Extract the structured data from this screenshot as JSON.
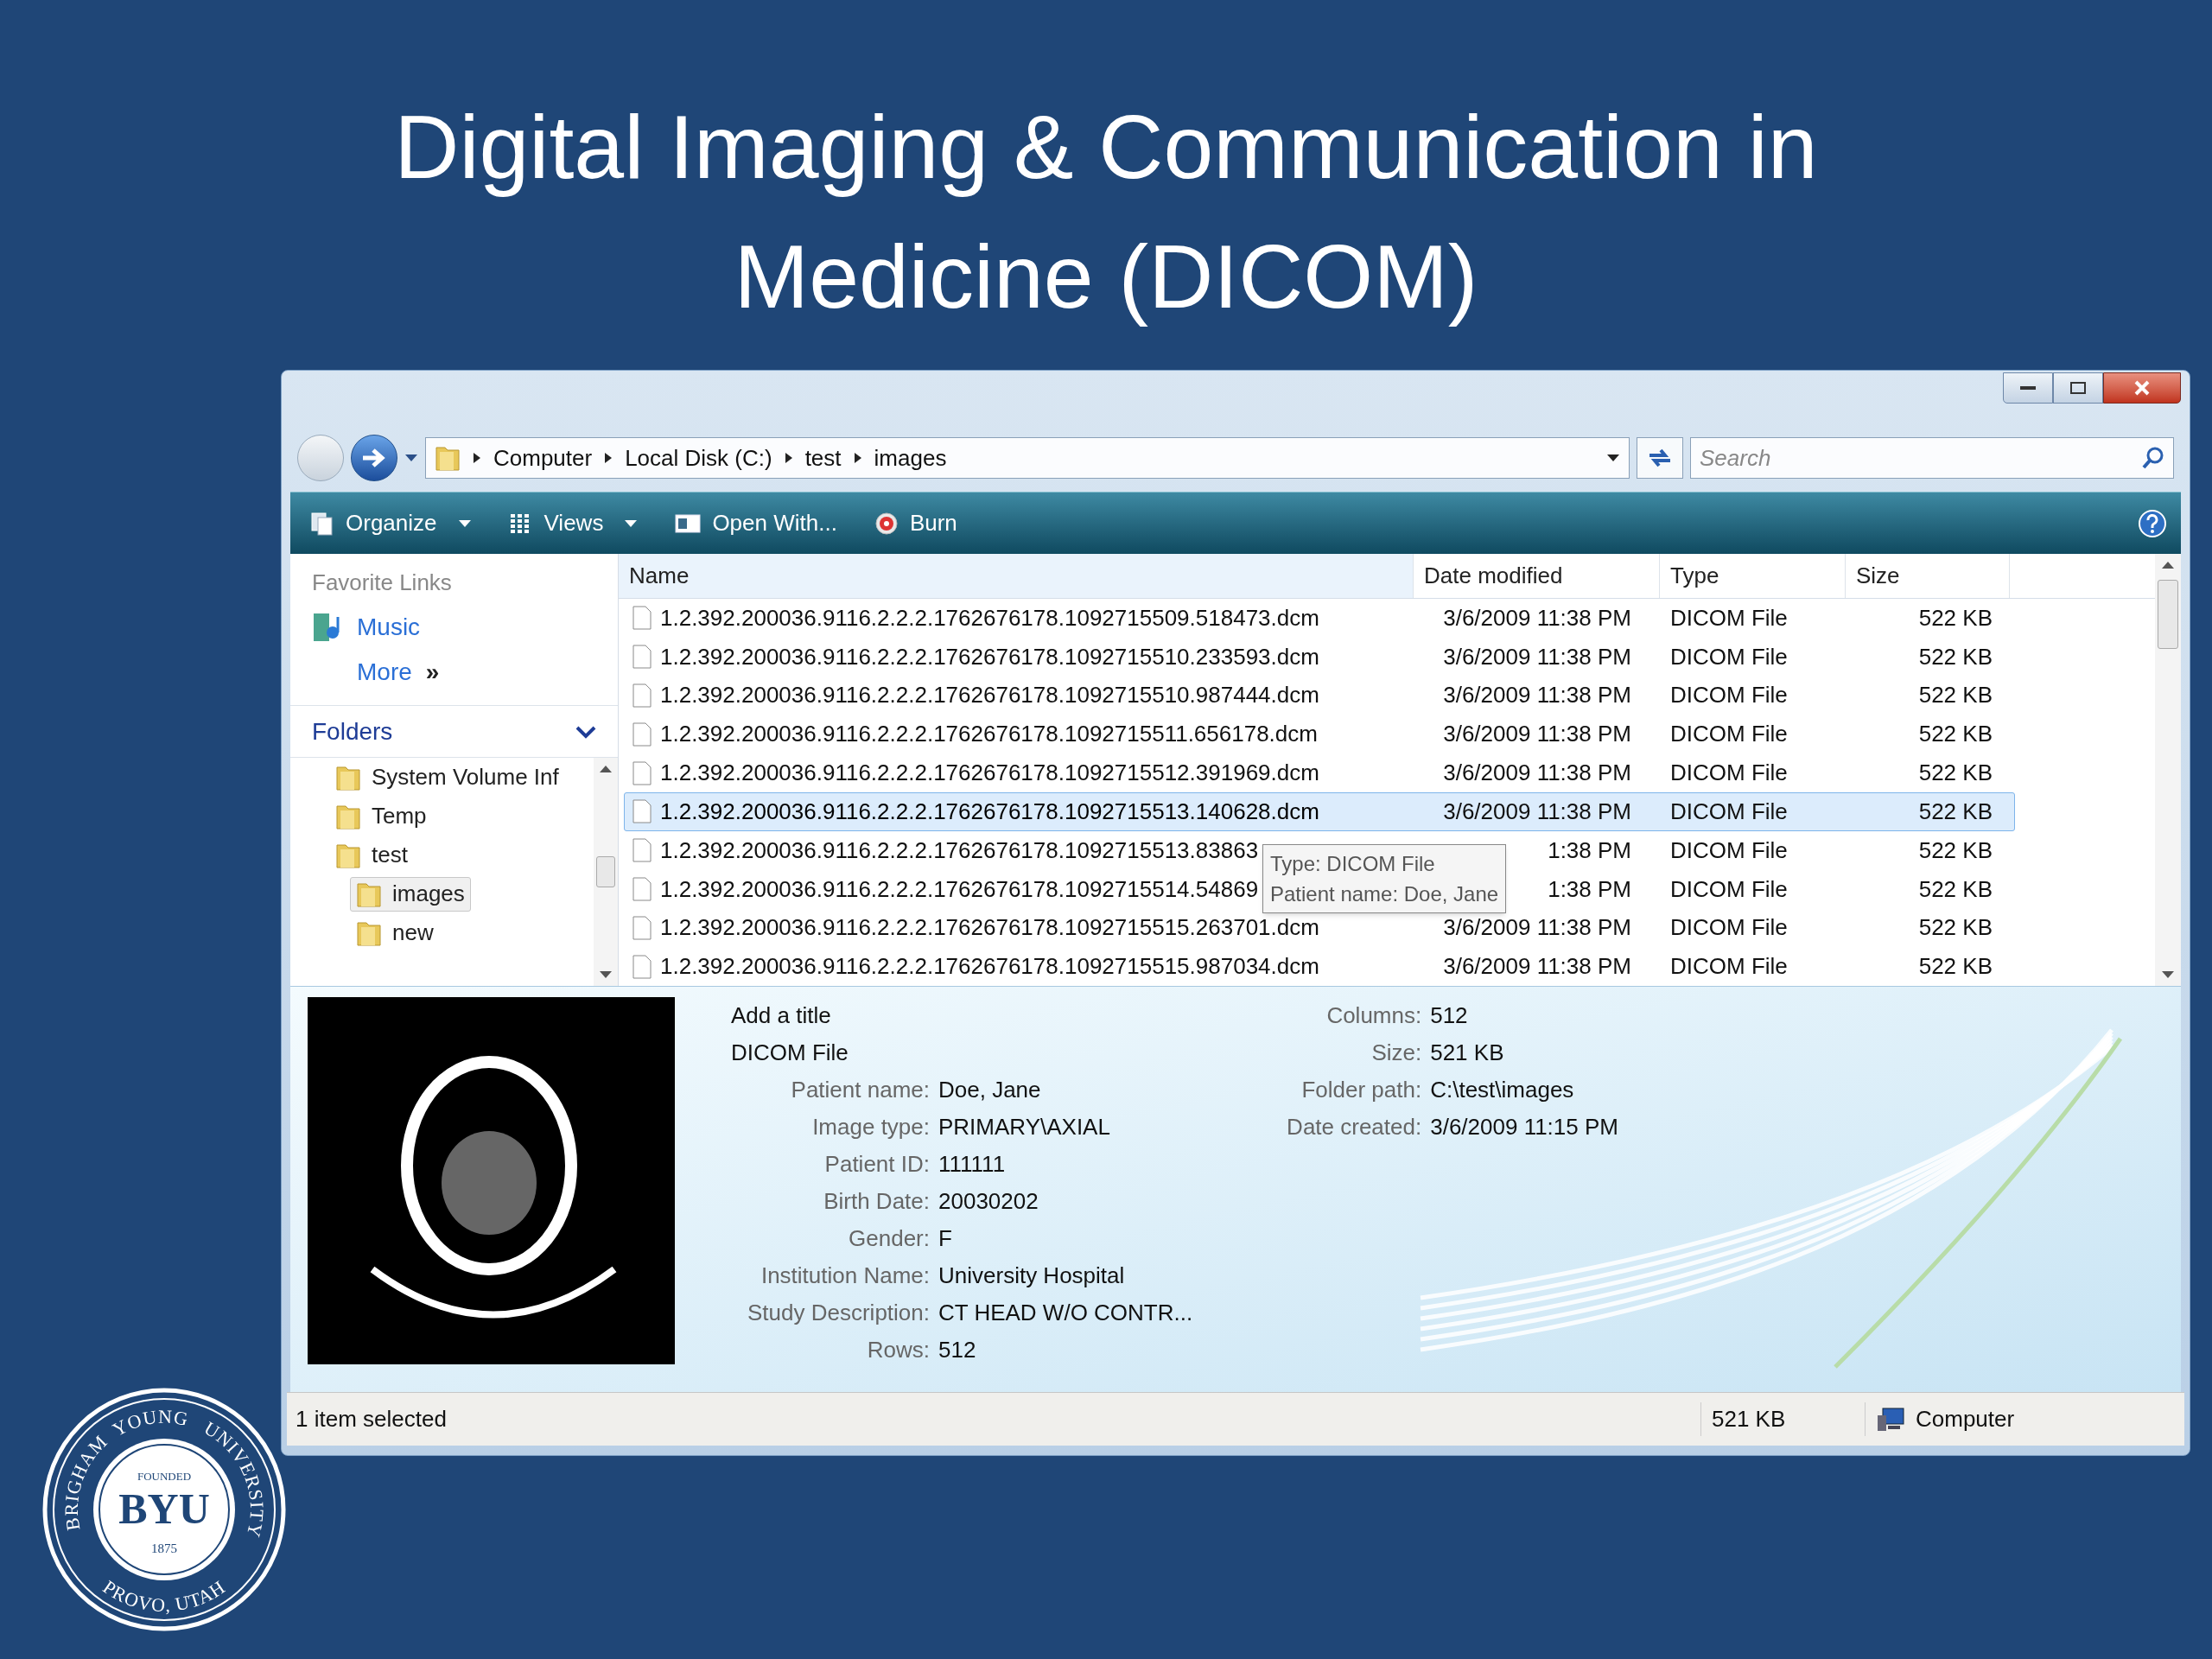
{
  "slide": {
    "title_lines": [
      "Digital Imaging & Communication in",
      "Medicine (DICOM)"
    ]
  },
  "window": {
    "address": {
      "crumbs": [
        "Computer",
        "Local Disk (C:)",
        "test",
        "images"
      ]
    },
    "search": {
      "placeholder": "Search"
    },
    "toolbar": [
      {
        "label": "Organize",
        "kind": "dropdown"
      },
      {
        "label": "Views",
        "kind": "dropdown"
      },
      {
        "label": "Open With...",
        "kind": "plain"
      },
      {
        "label": "Burn",
        "kind": "plain"
      }
    ],
    "favorite_links": {
      "heading": "Favorite Links",
      "items": [
        {
          "label": "Music",
          "kind": "link"
        },
        {
          "label": "More",
          "kind": "more",
          "suffix": "»"
        }
      ]
    },
    "folders": {
      "heading": "Folders",
      "items": [
        {
          "label": "System Volume Inf",
          "selected": false
        },
        {
          "label": "Temp",
          "selected": false
        },
        {
          "label": "test",
          "selected": false,
          "children": [
            {
              "label": "images",
              "selected": true
            },
            {
              "label": "new",
              "selected": false
            }
          ]
        }
      ]
    },
    "file_list": {
      "columns": [
        "Name",
        "Date modified",
        "Type",
        "Size"
      ],
      "rows": [
        {
          "name": "1.2.392.200036.9116.2.2.2.1762676178.1092715509.518473.dcm",
          "date": "3/6/2009 11:38 PM",
          "type": "DICOM File",
          "size": "522 KB",
          "selected": false
        },
        {
          "name": "1.2.392.200036.9116.2.2.2.1762676178.1092715510.233593.dcm",
          "date": "3/6/2009 11:38 PM",
          "type": "DICOM File",
          "size": "522 KB",
          "selected": false
        },
        {
          "name": "1.2.392.200036.9116.2.2.2.1762676178.1092715510.987444.dcm",
          "date": "3/6/2009 11:38 PM",
          "type": "DICOM File",
          "size": "522 KB",
          "selected": false
        },
        {
          "name": "1.2.392.200036.9116.2.2.2.1762676178.1092715511.656178.dcm",
          "date": "3/6/2009 11:38 PM",
          "type": "DICOM File",
          "size": "522 KB",
          "selected": false
        },
        {
          "name": "1.2.392.200036.9116.2.2.2.1762676178.1092715512.391969.dcm",
          "date": "3/6/2009 11:38 PM",
          "type": "DICOM File",
          "size": "522 KB",
          "selected": false
        },
        {
          "name": "1.2.392.200036.9116.2.2.2.1762676178.1092715513.140628.dcm",
          "date": "3/6/2009 11:38 PM",
          "type": "DICOM File",
          "size": "522 KB",
          "selected": true
        },
        {
          "name": "1.2.392.200036.9116.2.2.2.1762676178.1092715513.83863",
          "date": "1:38 PM",
          "type": "DICOM File",
          "size": "522 KB",
          "selected": false
        },
        {
          "name": "1.2.392.200036.9116.2.2.2.1762676178.1092715514.54869",
          "date": "1:38 PM",
          "type": "DICOM File",
          "size": "522 KB",
          "selected": false
        },
        {
          "name": "1.2.392.200036.9116.2.2.2.1762676178.1092715515.263701.dcm",
          "date": "3/6/2009 11:38 PM",
          "type": "DICOM File",
          "size": "522 KB",
          "selected": false
        },
        {
          "name": "1.2.392.200036.9116.2.2.2.1762676178.1092715515.987034.dcm",
          "date": "3/6/2009 11:38 PM",
          "type": "DICOM File",
          "size": "522 KB",
          "selected": false
        }
      ]
    },
    "tooltip": {
      "lines": [
        "Type: DICOM File",
        "Patient name: Doe, Jane"
      ]
    },
    "details": {
      "title": "Add a title",
      "file_type": "DICOM File",
      "fields": [
        {
          "label": "Patient name:",
          "value": "Doe, Jane"
        },
        {
          "label": "Image type:",
          "value": "PRIMARY\\AXIAL"
        },
        {
          "label": "Patient ID:",
          "value": "111111"
        },
        {
          "label": "Birth Date:",
          "value": "20030202"
        },
        {
          "label": "Gender:",
          "value": "F"
        },
        {
          "label": "Institution Name:",
          "value": "University Hospital"
        },
        {
          "label": "Study Description:",
          "value": "CT HEAD W/O CONTR..."
        },
        {
          "label": "Rows:",
          "value": "512"
        }
      ],
      "fields_2": [
        {
          "label": "Columns:",
          "value": "512"
        },
        {
          "label": "Size:",
          "value": "521 KB"
        },
        {
          "label": "Folder path:",
          "value": "C:\\test\\images"
        },
        {
          "label": "Date created:",
          "value": "3/6/2009 11:15 PM"
        }
      ]
    },
    "status_bar": {
      "selection": "1 item selected",
      "size": "521 KB",
      "location": "Computer"
    }
  },
  "logo": {
    "ring_top": [
      "BRIGHAM",
      "YOUNG",
      "UNIVERSITY"
    ],
    "ring_bottom": "PROVO, UTAH",
    "founded": "FOUNDED",
    "name": "BYU",
    "year": "1875"
  }
}
